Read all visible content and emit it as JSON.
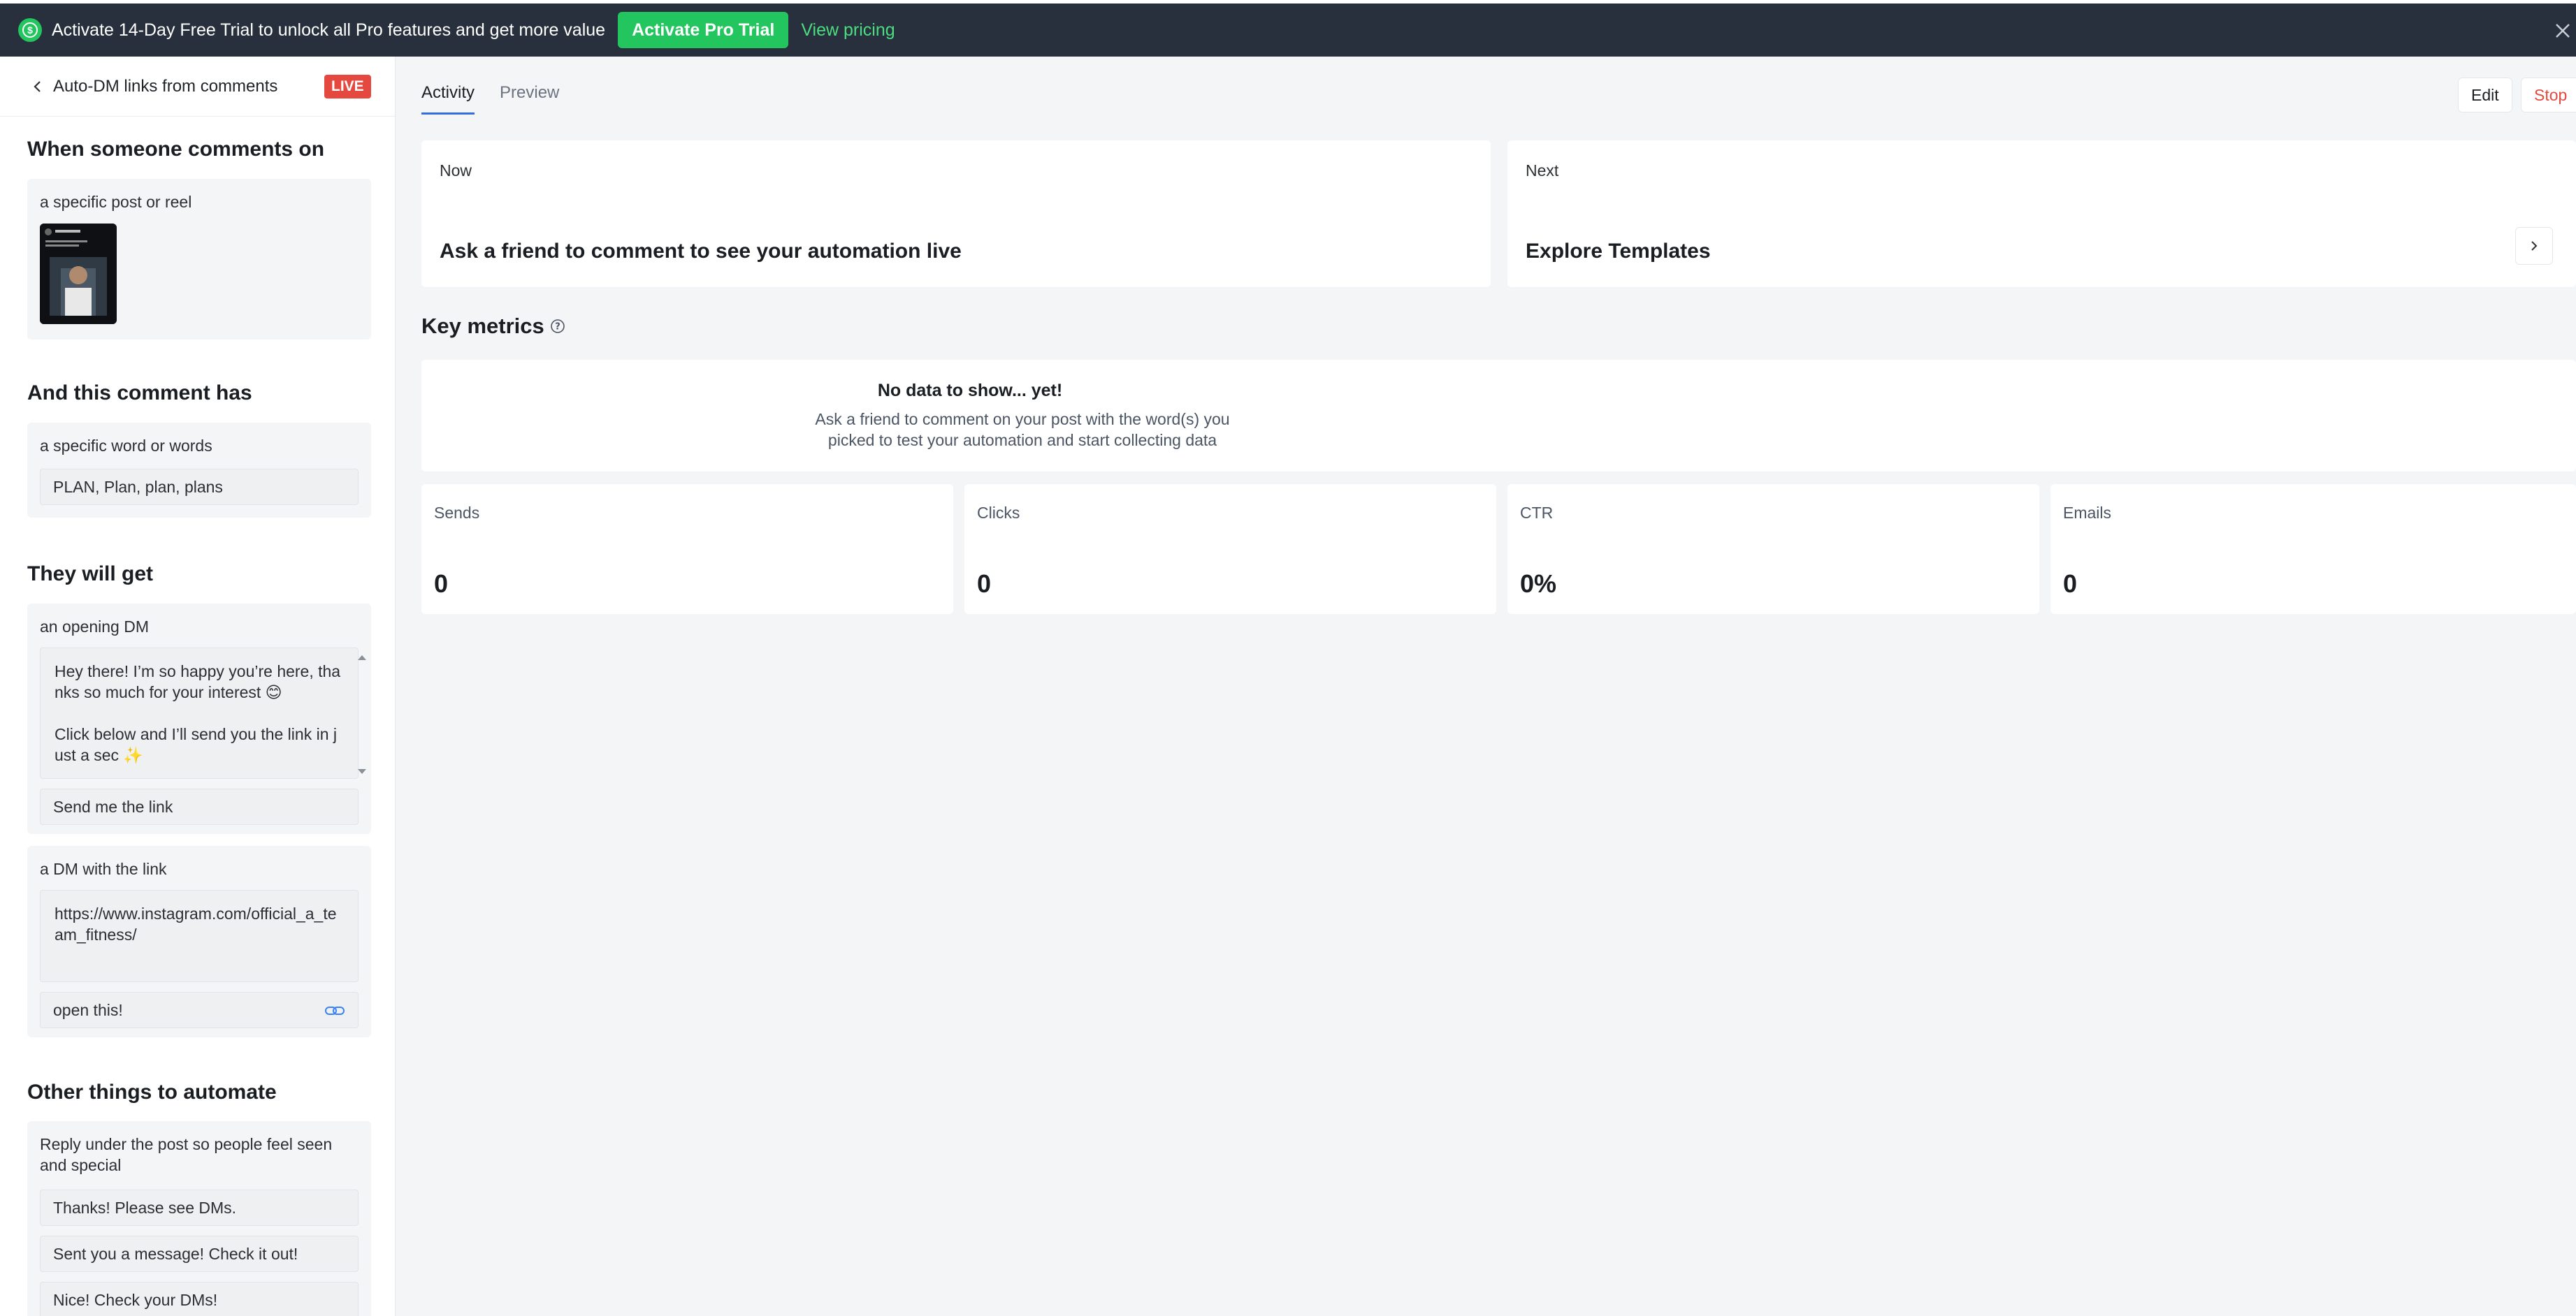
{
  "banner": {
    "message": "Activate 14-Day Free Trial to unlock all Pro features and get more value",
    "cta_label": "Activate Pro Trial",
    "pricing_label": "View pricing",
    "icon": "dollar-circle-icon",
    "accent_color": "#22c55e"
  },
  "sidebar": {
    "title": "Auto-DM links from comments",
    "status_badge": "LIVE",
    "trigger": {
      "heading": "When someone comments on",
      "label": "a specific post or reel"
    },
    "condition": {
      "heading": "And this comment has",
      "label": "a specific word or words",
      "keywords": "PLAN, Plan, plan, plans"
    },
    "reward": {
      "heading": "They will get",
      "opening_label": "an opening DM",
      "opening_message": "Hey there! I’m so happy you’re here, thanks so much for your interest 😊\n\nClick below and I’ll send you the link in just a sec ✨",
      "button_text": "Send me the link",
      "link_label": "a DM with the link",
      "link_url": "https://www.instagram.com/official_a_team_fitness/",
      "link_button_text": "open this!"
    },
    "other": {
      "heading": "Other things to automate",
      "label": "Reply under the post so people feel seen and special",
      "replies": [
        "Thanks! Please see DMs.",
        "Sent you a message! Check it out!",
        "Nice! Check your DMs!"
      ]
    }
  },
  "main": {
    "tabs": [
      "Activity",
      "Preview"
    ],
    "active_tab": "Activity",
    "edit_label": "Edit",
    "stop_label": "Stop",
    "now": {
      "label": "Now",
      "text": "Ask a friend to comment to see your automation live"
    },
    "next": {
      "label": "Next",
      "text": "Explore Templates"
    },
    "key_metrics_title": "Key metrics",
    "empty_title": "No data to show... yet!",
    "empty_text": "Ask a friend to comment on your post with the word(s) you picked to test your automation and start collecting data",
    "metrics": [
      {
        "label": "Sends",
        "value": "0"
      },
      {
        "label": "Clicks",
        "value": "0"
      },
      {
        "label": "CTR",
        "value": "0%"
      },
      {
        "label": "Emails",
        "value": "0"
      }
    ]
  }
}
